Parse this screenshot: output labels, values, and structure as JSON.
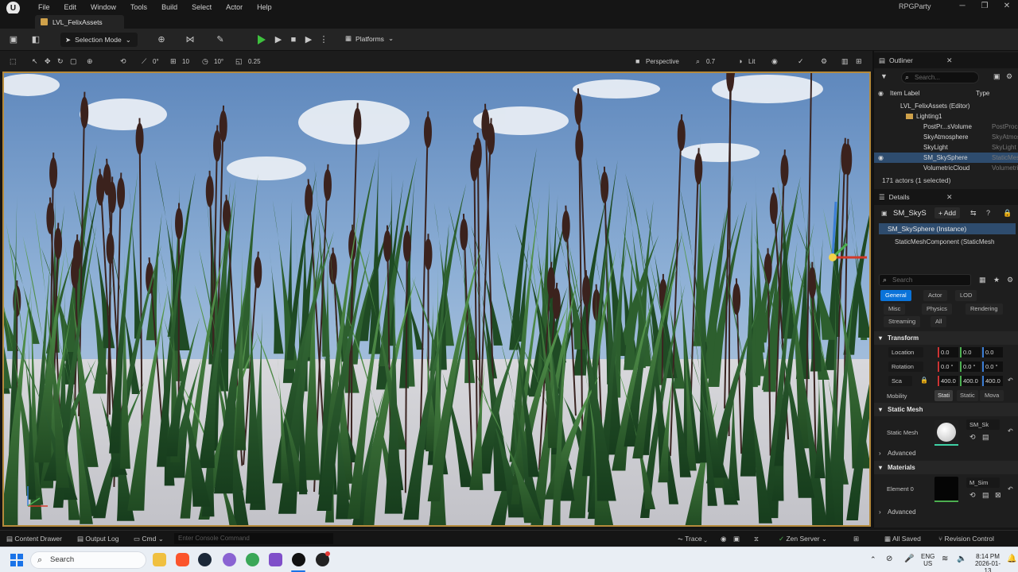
{
  "menu": {
    "logo": "U",
    "items": [
      "File",
      "Edit",
      "Window",
      "Tools",
      "Build",
      "Select",
      "Actor",
      "Help"
    ],
    "project": "RPGParty"
  },
  "window_controls": {
    "minimize": "─",
    "restore": "❐",
    "close": "✕"
  },
  "level_tab": {
    "label": "LVL_FelixAssets"
  },
  "toolbar": {
    "selection_mode": "Selection Mode",
    "platforms": "Platforms"
  },
  "viewport_toolbar": {
    "rot_snap_angle": "0°",
    "grid_snap": "10",
    "angle_snap": "10°",
    "scale_snap": "0.25",
    "view_mode": "Perspective",
    "camera_speed": "0.7",
    "lit": "Lit"
  },
  "outliner": {
    "title": "Outliner",
    "search_placeholder": "Search...",
    "col_label": "Item Label",
    "col_type": "Type",
    "rows": [
      {
        "label": "LVL_FelixAssets (Editor)",
        "type": ""
      },
      {
        "label": "Lighting1",
        "type": ""
      },
      {
        "label": "PostPr...sVolume",
        "type": "PostProce"
      },
      {
        "label": "SkyAtmosphere",
        "type": "SkyAtmos"
      },
      {
        "label": "SkyLight",
        "type": "SkyLight"
      },
      {
        "label": "SM_SkySphere",
        "type": "StaticMes"
      },
      {
        "label": "VolumetricCloud",
        "type": "Volumetric"
      }
    ],
    "footer": "171 actors (1 selected)"
  },
  "details": {
    "title": "Details",
    "actor_name": "SM_SkyS",
    "add_button": "+ Add",
    "instance": "SM_SkySphere (Instance)",
    "component": "StaticMeshComponent (StaticMesh",
    "search_placeholder": "Search",
    "filters_row1": [
      "General",
      "Actor",
      "LOD"
    ],
    "filters_row2": [
      "Misc",
      "Physics",
      "Rendering"
    ],
    "filters_row3": [
      "Streaming",
      "All"
    ],
    "transform": {
      "header": "Transform",
      "location_label": "Location",
      "rotation_label": "Rotation",
      "scale_label": "Sca",
      "location": [
        "0.0",
        "0.0",
        "0.0"
      ],
      "rotation": [
        "0.0 °",
        "0.0 °",
        "0.0 °"
      ],
      "scale": [
        "400.0",
        "400.0",
        "400.0"
      ],
      "mobility_label": "Mobility",
      "mobility": [
        "Stati",
        "Static",
        "Mova"
      ]
    },
    "static_mesh": {
      "header": "Static Mesh",
      "label": "Static Mesh",
      "value": "SM_Sk",
      "advanced": "Advanced"
    },
    "materials": {
      "header": "Materials",
      "element_label": "Element 0",
      "value": "M_Sim",
      "advanced": "Advanced"
    }
  },
  "statusbar": {
    "content_drawer": "Content Drawer",
    "output_log": "Output Log",
    "cmd": "Cmd",
    "console_placeholder": "Enter Console Command",
    "trace": "Trace",
    "zen_server": "Zen Server",
    "all_saved": "All Saved",
    "revision_control": "Revision Control"
  },
  "taskbar": {
    "search": "Search",
    "lang": "ENG",
    "region": "US",
    "time": "8:14 PM",
    "date": "2026-01-13"
  },
  "colors": {
    "accent": "#0a73d9",
    "selection": "#2e4c6e",
    "viewport_border": "#b58a3b",
    "play": "#3ec13e"
  }
}
